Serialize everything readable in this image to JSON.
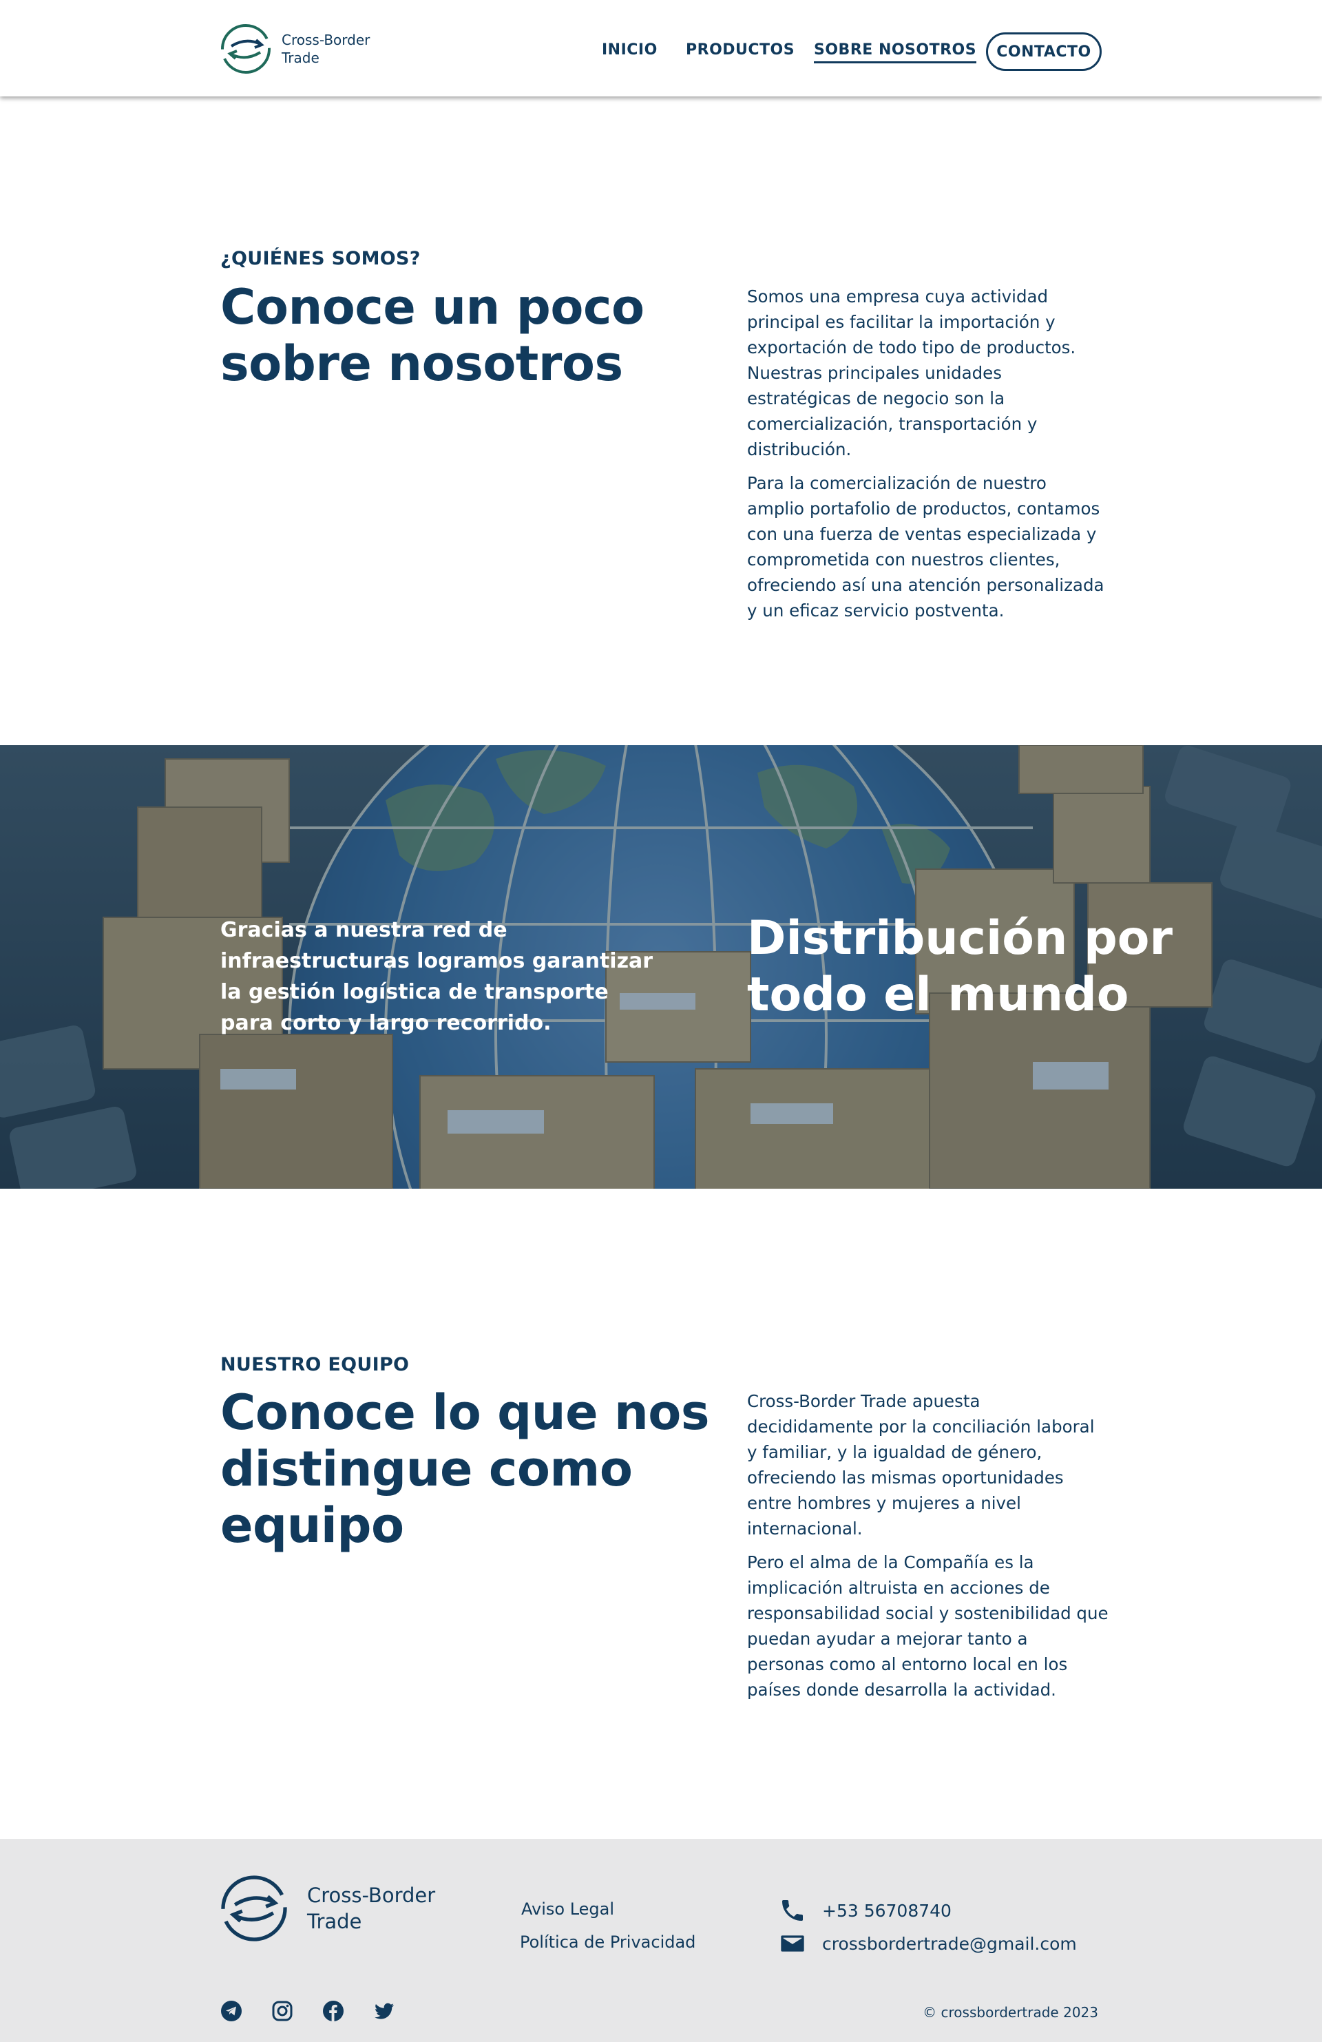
{
  "header": {
    "brand_line1": "Cross-Border",
    "brand_line2": "Trade",
    "nav": {
      "inicio": "INICIO",
      "productos": "PRODUCTOS",
      "sobre_nosotros": "SOBRE NOSOTROS",
      "contacto": "CONTACTO"
    },
    "active_nav": "SOBRE NOSOTROS"
  },
  "about": {
    "eyebrow": "¿QUIÉNES SOMOS?",
    "heading": "Conoce un poco sobre nosotros",
    "paragraph1": "Somos una empresa cuya actividad principal es facilitar la importación y exportación de todo tipo de productos. Nuestras principales unidades estratégicas de negocio son la comercialización, transportación y distribución.",
    "paragraph2": "Para la comercialización de nuestro amplio portafolio de productos, contamos con una fuerza de ventas especializada y comprometida con nuestros clientes, ofreciendo así una atención personalizada y un eficaz servicio postventa."
  },
  "banner": {
    "left_text": "Gracias a nuestra red de infraestructuras logramos garantizar la gestión logística de transporte para corto y largo recorrido.",
    "right_heading": "Distribución por todo el mundo"
  },
  "team": {
    "eyebrow": "NUESTRO EQUIPO",
    "heading": "Conoce lo que nos distingue como equipo",
    "paragraph1": "Cross-Border Trade apuesta decididamente por la conciliación laboral y familiar, y la igualdad de género, ofreciendo las mismas oportunidades entre hombres y mujeres a nivel internacional.",
    "paragraph2": "Pero el alma de la Compañía es la implicación altruista en acciones de responsabilidad social y sostenibilidad que puedan ayudar a mejorar tanto a personas como al entorno local en los países donde desarrolla la actividad."
  },
  "footer": {
    "brand_line1": "Cross-Border",
    "brand_line2": "Trade",
    "legal": "Aviso Legal",
    "privacy": "Política de Privacidad",
    "phone": "+53 56708740",
    "email": "crossbordertrade@gmail.com",
    "copyright": "© crossbordertrade 2023",
    "socials": [
      "telegram-icon",
      "instagram-icon",
      "facebook-icon",
      "twitter-icon"
    ]
  },
  "colors": {
    "primary": "#113a5c",
    "logo_green": "#1f6a5a",
    "footer_bg": "#e7e7e8",
    "white": "#ffffff"
  }
}
